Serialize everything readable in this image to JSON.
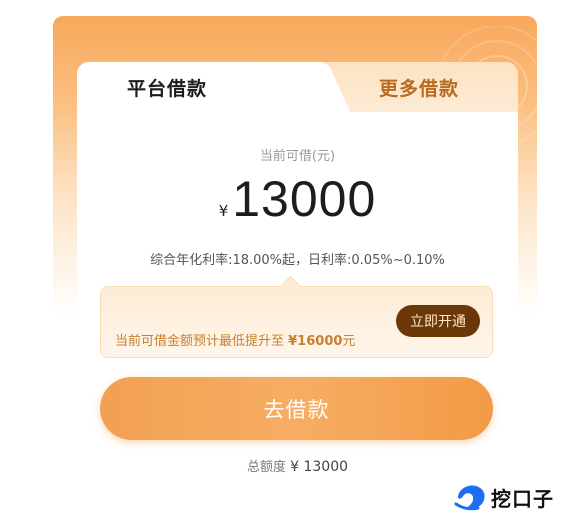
{
  "tabs": [
    {
      "label": "平台借款",
      "active": true
    },
    {
      "label": "更多借款",
      "active": false
    }
  ],
  "loan": {
    "available_label": "当前可借(元)",
    "currency_symbol": "¥",
    "amount": "13000",
    "rate_text": "综合年化利率:18.00%起，日利率:0.05%~0.10%"
  },
  "promo": {
    "text_prefix": "当前可借金额预计最低提升至 ",
    "amount": "¥16000",
    "text_suffix": "元",
    "button_label": "立即开通"
  },
  "borrow_button_label": "去借款",
  "total": {
    "label": "总额度 ",
    "value": "¥ 13000"
  },
  "watermark": {
    "text": "挖口子",
    "icon": "dolphin-logo-icon"
  },
  "colors": {
    "accent": "#f39a45",
    "promo_button": "#6a3708",
    "tab_inactive_text": "#b86b20",
    "promo_text": "#c7802f"
  }
}
